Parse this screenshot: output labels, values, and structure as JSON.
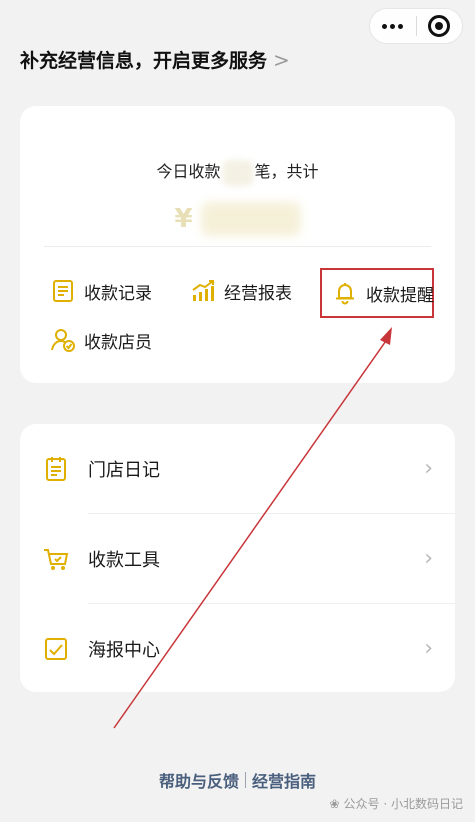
{
  "top_link": {
    "label": "补充经营信息，开启更多服务",
    "chevron": ">"
  },
  "summary": {
    "today_prefix": "今日收款",
    "today_suffix": "笔，共计",
    "currency": "¥"
  },
  "quick_actions": [
    {
      "label": "收款记录",
      "icon": "receipt-icon"
    },
    {
      "label": "经营报表",
      "icon": "chart-growth-icon"
    },
    {
      "label": "收款提醒",
      "icon": "bell-icon"
    },
    {
      "label": "收款店员",
      "icon": "staff-icon"
    }
  ],
  "menu": [
    {
      "label": "门店日记",
      "icon": "diary-icon"
    },
    {
      "label": "收款工具",
      "icon": "cart-icon"
    },
    {
      "label": "海报中心",
      "icon": "poster-icon"
    }
  ],
  "footer": {
    "help": "帮助与反馈",
    "guide": "经营指南"
  },
  "watermark": "公众号 · 小北数码日记",
  "colors": {
    "accent_gold": "#e0b000",
    "highlight_red": "#c8363a",
    "link_blue": "#4a5f7d"
  }
}
